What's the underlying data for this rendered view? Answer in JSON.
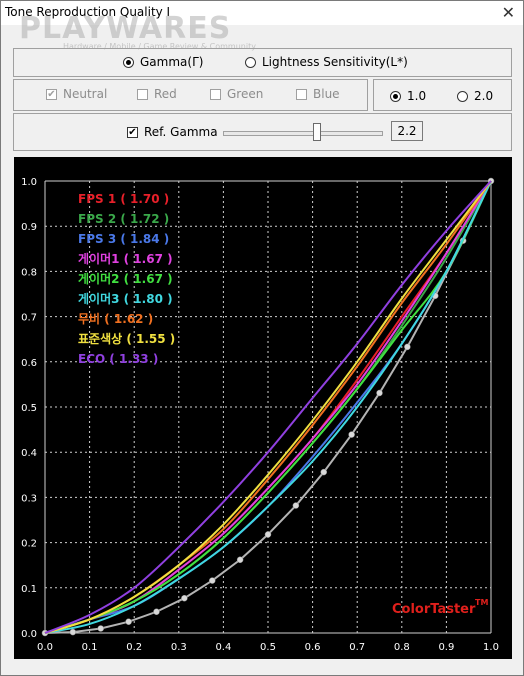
{
  "window": {
    "title": "Tone Reproduction Quality I",
    "close_symbol": "✕"
  },
  "watermark": {
    "brand": "PLAYWARES",
    "tagline": "Hardware / Mobile / Game Review & Community"
  },
  "mode": {
    "gamma_label": "Gamma(Γ)",
    "lightness_label": "Lightness Sensitivity(L*)",
    "selected": "gamma"
  },
  "channels": {
    "neutral": "Neutral",
    "red": "Red",
    "green": "Green",
    "blue": "Blue",
    "neutral_checked": "✔"
  },
  "scale": {
    "opt1": "1.0",
    "opt2": "2.0",
    "selected": "1.0"
  },
  "ref_gamma": {
    "label": "Ref. Gamma",
    "checked": "✔",
    "value": "2.2",
    "slider_level": 0.6
  },
  "chart_data": {
    "type": "line",
    "x": [
      0.0,
      0.1,
      0.2,
      0.3,
      0.4,
      0.5,
      0.6,
      0.7,
      0.8,
      0.9,
      1.0
    ],
    "xlim": [
      0,
      1
    ],
    "ylim": [
      0,
      1
    ],
    "xticks": [
      "0.0",
      "0.1",
      "0.2",
      "0.3",
      "0.4",
      "0.5",
      "0.6",
      "0.7",
      "0.8",
      "0.9",
      "1.0"
    ],
    "yticks": [
      "0.0",
      "0.1",
      "0.2",
      "0.3",
      "0.4",
      "0.5",
      "0.6",
      "0.7",
      "0.8",
      "0.9",
      "1.0"
    ],
    "grid": true,
    "legend_position": "top-left",
    "watermark_text": "ColorTaster",
    "watermark_tm": "TM",
    "colors": {
      "bg": "#000000",
      "grid": "#d0d0d0",
      "axis_text": "#ffffff",
      "brand": "#e0201c"
    },
    "series": [
      {
        "name": "FPS 1 ( 1.70 )",
        "color": "#e8202a",
        "values": [
          0.0,
          0.03,
          0.07,
          0.14,
          0.22,
          0.32,
          0.43,
          0.56,
          0.7,
          0.84,
          1.0
        ]
      },
      {
        "name": "FPS 2 ( 1.72 )",
        "color": "#3aa84a",
        "values": [
          0.0,
          0.03,
          0.07,
          0.13,
          0.21,
          0.31,
          0.42,
          0.54,
          0.68,
          0.83,
          1.0
        ]
      },
      {
        "name": "FPS 3 ( 1.84 )",
        "color": "#4a78e8",
        "values": [
          0.0,
          0.03,
          0.06,
          0.12,
          0.19,
          0.28,
          0.39,
          0.51,
          0.64,
          0.8,
          1.0
        ]
      },
      {
        "name": "게이머1 ( 1.67 )",
        "color": "#e040e0",
        "values": [
          0.0,
          0.03,
          0.07,
          0.14,
          0.22,
          0.32,
          0.43,
          0.55,
          0.69,
          0.84,
          1.0
        ]
      },
      {
        "name": "게이머2 ( 1.67 )",
        "color": "#40e040",
        "values": [
          0.0,
          0.03,
          0.07,
          0.13,
          0.21,
          0.31,
          0.42,
          0.54,
          0.67,
          0.8,
          1.0
        ]
      },
      {
        "name": "게이머3 ( 1.80 )",
        "color": "#40d8e0",
        "values": [
          0.0,
          0.02,
          0.06,
          0.12,
          0.19,
          0.28,
          0.38,
          0.5,
          0.64,
          0.8,
          1.0
        ]
      },
      {
        "name": "무비 ( 1.62 )",
        "color": "#f07020",
        "values": [
          0.0,
          0.03,
          0.08,
          0.15,
          0.23,
          0.34,
          0.46,
          0.59,
          0.73,
          0.86,
          1.0
        ]
      },
      {
        "name": "표준색상 ( 1.55 )",
        "color": "#f0e040",
        "values": [
          0.0,
          0.03,
          0.08,
          0.15,
          0.24,
          0.35,
          0.47,
          0.6,
          0.74,
          0.87,
          1.0
        ]
      },
      {
        "name": "ECO ( 1.33 )",
        "color": "#9040e0",
        "values": [
          0.0,
          0.04,
          0.1,
          0.19,
          0.29,
          0.4,
          0.52,
          0.64,
          0.77,
          0.89,
          1.0
        ]
      }
    ],
    "reference": {
      "color": "#b4b4b4",
      "x": [
        0.0,
        0.0625,
        0.125,
        0.1875,
        0.25,
        0.3125,
        0.375,
        0.4375,
        0.5,
        0.5625,
        0.625,
        0.6875,
        0.75,
        0.8125,
        0.875,
        0.9375,
        1.0
      ],
      "values": [
        0.0,
        0.002,
        0.01,
        0.025,
        0.047,
        0.077,
        0.116,
        0.162,
        0.218,
        0.282,
        0.356,
        0.439,
        0.531,
        0.633,
        0.746,
        0.868,
        1.0
      ]
    }
  }
}
